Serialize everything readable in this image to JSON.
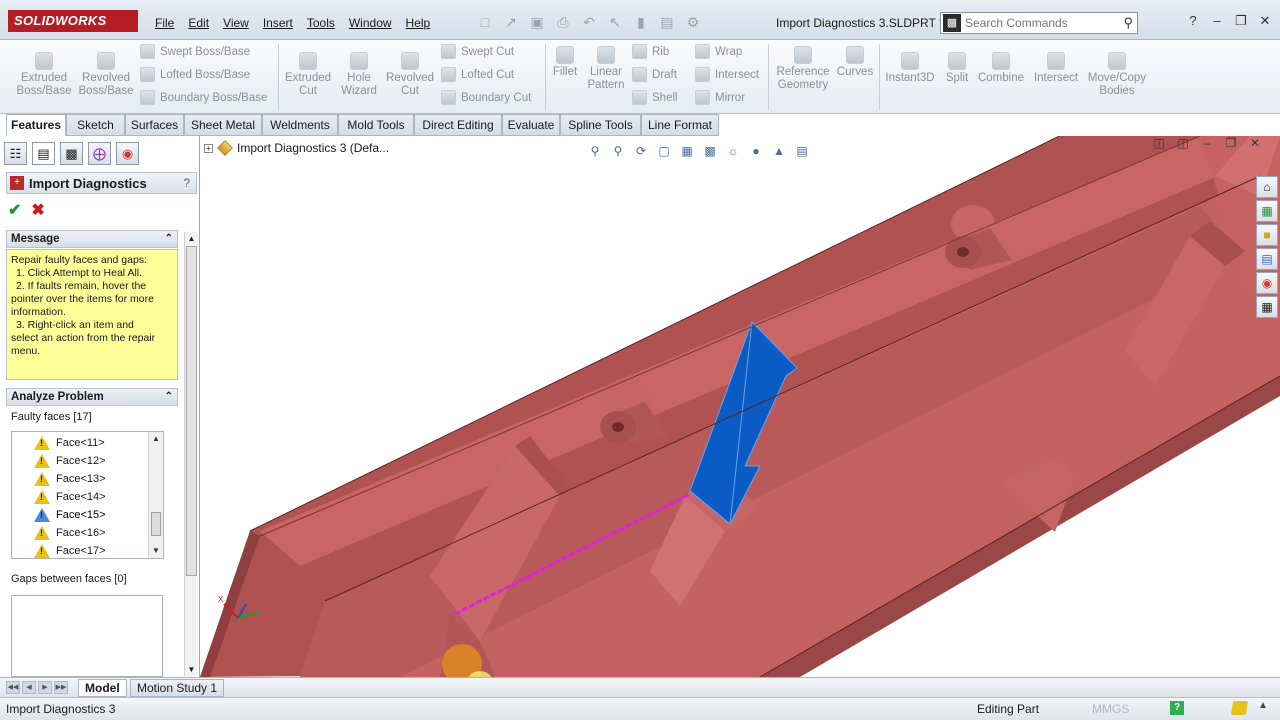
{
  "app": {
    "logo": "SOLIDWORKS",
    "menus": [
      "File",
      "Edit",
      "View",
      "Insert",
      "Tools",
      "Window",
      "Help"
    ],
    "document_title": "Import Diagnostics 3.SLDPRT *",
    "search_placeholder": "Search Commands"
  },
  "commandmanager": {
    "extruded_boss": "Extruded\nBoss/Base",
    "revolved_boss": "Revolved\nBoss/Base",
    "swept_boss": "Swept Boss/Base",
    "lofted_boss": "Lofted Boss/Base",
    "boundary_boss": "Boundary Boss/Base",
    "extruded_cut": "Extruded\nCut",
    "hole_wizard": "Hole\nWizard",
    "revolved_cut": "Revolved\nCut",
    "swept_cut": "Swept Cut",
    "lofted_cut": "Lofted Cut",
    "boundary_cut": "Boundary Cut",
    "fillet": "Fillet",
    "linear_pattern": "Linear\nPattern",
    "rib": "Rib",
    "draft": "Draft",
    "shell": "Shell",
    "wrap": "Wrap",
    "intersect": "Intersect",
    "mirror": "Mirror",
    "reference_geometry": "Reference\nGeometry",
    "curves": "Curves",
    "instant3d": "Instant3D",
    "split": "Split",
    "combine": "Combine",
    "intersect2": "Intersect",
    "move_copy_bodies": "Move/Copy\nBodies"
  },
  "tabs": [
    "Features",
    "Sketch",
    "Surfaces",
    "Sheet Metal",
    "Weldments",
    "Mold Tools",
    "Direct Editing",
    "Evaluate",
    "Spline Tools",
    "Line Format"
  ],
  "property_manager": {
    "title": "Import Diagnostics",
    "help": "?",
    "message_header": "Message",
    "message_lines": [
      "Repair faulty faces and gaps:",
      "  1. Click Attempt to Heal All.",
      "  2. If faults remain, hover the",
      "pointer over the items for more",
      "information.",
      "  3. Right-click an item and",
      "select an action from the repair",
      "menu."
    ],
    "analyze_header": "Analyze Problem",
    "faulty_faces_label": "Faulty faces [17]",
    "faces": [
      "Face<11>",
      "Face<12>",
      "Face<13>",
      "Face<14>",
      "Face<15>",
      "Face<16>",
      "Face<17>"
    ],
    "gaps_label": "Gaps between faces [0]"
  },
  "graphics": {
    "tree_root": "Import Diagnostics 3  (Defa...",
    "model_color": "#b85a5a",
    "highlight_color": "#0a5bc4",
    "edge_highlight_color": "#e020e0"
  },
  "bottom_tabs": [
    "Model",
    "Motion Study 1"
  ],
  "status": {
    "left": "Import Diagnostics 3",
    "mode": "Editing Part",
    "units": "MMGS"
  }
}
